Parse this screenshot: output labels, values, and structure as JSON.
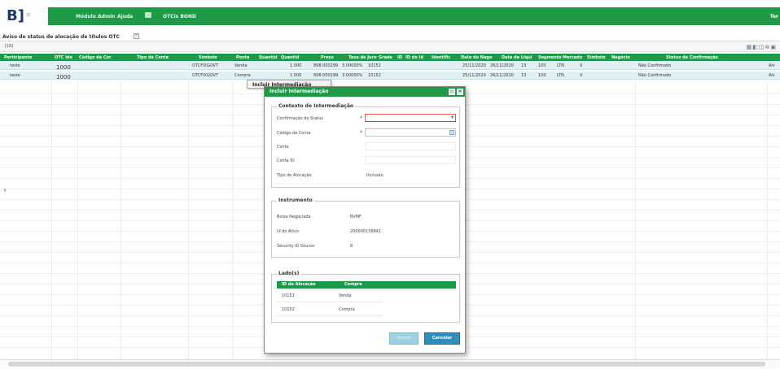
{
  "header": {
    "logo_text": "B]",
    "logo_sub": "≡",
    "nav": [
      "Módulo",
      "Admin",
      "Ajuda",
      "OTCis BOND"
    ],
    "user": "Ter"
  },
  "tab": {
    "label": "Aviso de status de alocação de títulos OTC",
    "close": "×"
  },
  "subbar": {
    "count": "[18]",
    "tools": "▦◧◫⊗▣"
  },
  "grid": {
    "headers": [
      "Participante",
      "OTC Ide",
      "Código da Cor",
      "Tipo de Conta",
      "Símbolo",
      "Ponta",
      "Quantid",
      "Quantid",
      "Preço",
      "Taxa de Juro",
      "Grade",
      "ID",
      "ID do Id",
      "Identific",
      "Data do Nego",
      "Data da Liqui",
      "Segmento",
      "Mercado",
      "Símbolo",
      "Negócio",
      "Status de Confirmação"
    ],
    "rows": [
      {
        "participante": "teste",
        "otc": "1000",
        "simbolo": "OTCFIXGOVT",
        "ponta": "Venda",
        "quantidade": "1.000",
        "preco": "898.000299",
        "taxa": "3.00000%",
        "id": "10151",
        "data_neg": "25/11/2020",
        "data_liq": "26/11/2020",
        "segmento": "13",
        "mercado": "100",
        "simbolo2": "LTN",
        "negocio": "V",
        "status": "Não Confirmado",
        "extra": "Alv"
      },
      {
        "participante": "teste",
        "otc": "1000",
        "simbolo": "OTCFIXGOVT",
        "ponta": "Compra",
        "quantidade": "1.000",
        "preco": "898.000299",
        "taxa": "3.00000%",
        "id": "10152",
        "data_neg": "25/11/2020",
        "data_liq": "26/11/2020",
        "segmento": "13",
        "mercado": "100",
        "simbolo2": "LTN",
        "negocio": "V",
        "status": "Não Confirmado",
        "extra": "Alv"
      }
    ]
  },
  "context_menu": {
    "item": "Incluir Intermediação"
  },
  "modal": {
    "title": "Incluir Intermediação",
    "contexto": {
      "legend": "Contexto de Intermediação",
      "confirmacao_label": "Confirmação do Status",
      "confirmacao_value": "",
      "codigo_conta_label": "Código da Conta",
      "codigo_conta_value": "",
      "conta_label": "Conta",
      "conta_value": "",
      "conta_id_label": "Conta ID",
      "conta_id_value": "",
      "tipo_alocacao_label": "Tipo de Alocação",
      "tipo_alocacao_value": "Inclusão",
      "required_mark": "*"
    },
    "instrumento": {
      "legend": "Instrumento",
      "bolsa_label": "Bolsa Negociada",
      "bolsa_value": "BVMF",
      "id_ativo_label": "Id do Ativo",
      "id_ativo_value": "200000156841",
      "security_label": "Security ID Source",
      "security_value": "8"
    },
    "lados": {
      "legend": "Lado(s)",
      "headers": [
        "ID de Alocação",
        "Compra"
      ],
      "rows": [
        {
          "id": "10151",
          "lado": "Venda"
        },
        {
          "id": "10152",
          "lado": "Compra"
        }
      ]
    },
    "buttons": {
      "fechar": "Fechar",
      "cancelar": "Cancelar"
    }
  },
  "colors": {
    "brand_green": "#1e9a46",
    "row_highlight": "#dff0f6",
    "primary_button": "#2c8fbd"
  }
}
